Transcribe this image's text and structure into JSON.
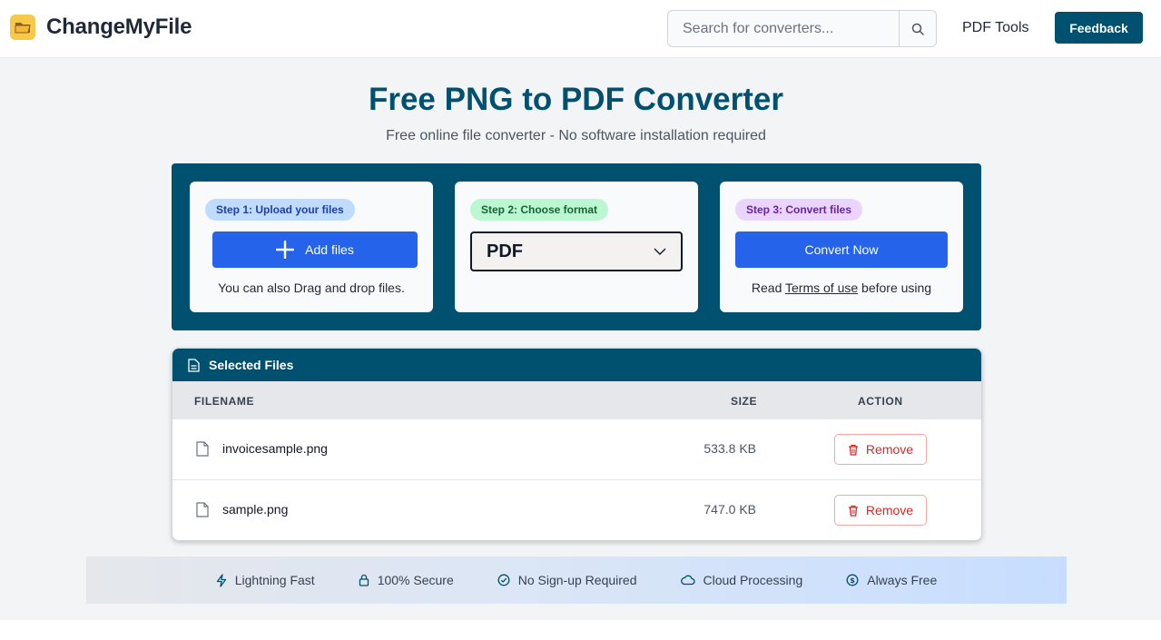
{
  "header": {
    "brand": "ChangeMyFile",
    "search_placeholder": "Search for converters...",
    "nav_link": "PDF Tools",
    "feedback_label": "Feedback"
  },
  "hero": {
    "title": "Free PNG to PDF Converter",
    "subtitle": "Free online file converter - No software installation required"
  },
  "steps": {
    "step1": {
      "badge": "Step 1: Upload your files",
      "button": "Add files",
      "note": "You can also Drag and drop files."
    },
    "step2": {
      "badge": "Step 2: Choose format",
      "selected_format": "PDF"
    },
    "step3": {
      "badge": "Step 3: Convert files",
      "button": "Convert Now",
      "note_prefix": "Read ",
      "note_link": "Terms of use",
      "note_suffix": " before using"
    }
  },
  "files": {
    "heading": "Selected Files",
    "columns": {
      "filename": "FILENAME",
      "size": "SIZE",
      "action": "ACTION"
    },
    "rows": [
      {
        "name": "invoicesample.png",
        "size": "533.8 KB",
        "action": "Remove"
      },
      {
        "name": "sample.png",
        "size": "747.0 KB",
        "action": "Remove"
      }
    ]
  },
  "features": [
    {
      "icon": "lightning-icon",
      "label": "Lightning Fast"
    },
    {
      "icon": "lock-icon",
      "label": "100% Secure"
    },
    {
      "icon": "check-circle-icon",
      "label": "No Sign-up Required"
    },
    {
      "icon": "cloud-icon",
      "label": "Cloud Processing"
    },
    {
      "icon": "dollar-circle-icon",
      "label": "Always Free"
    }
  ],
  "colors": {
    "brand": "#00506f",
    "primary": "#2563eb",
    "danger": "#dc2626"
  }
}
